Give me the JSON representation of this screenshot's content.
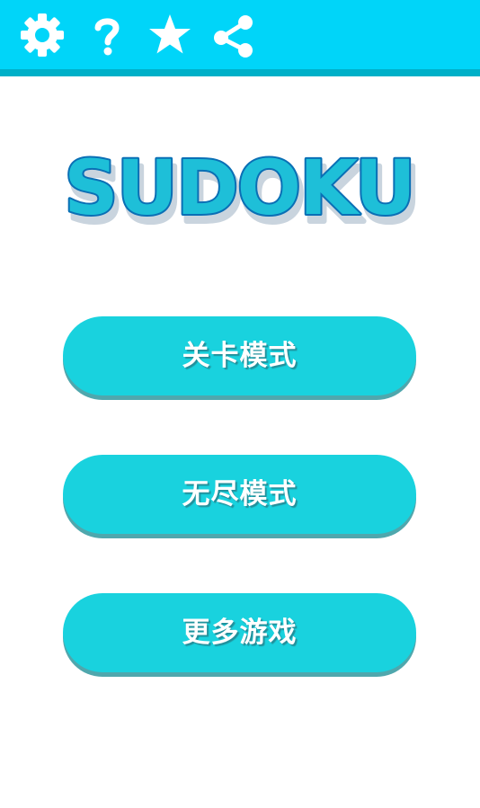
{
  "toolbar": {
    "icons": [
      "gear-icon",
      "help-icon",
      "star-icon",
      "share-icon"
    ],
    "background_color": "#00d5f9",
    "border_color": "#00b0c8",
    "icon_color": "#ffffff"
  },
  "logo": {
    "text": "SUDOKU",
    "fill_color": "#1ebfd8",
    "outline_color": "#0a6fb5",
    "shadow_color": "#c9d4de"
  },
  "menu": {
    "button_color": "#19d2de",
    "items": [
      {
        "label": "关卡模式"
      },
      {
        "label": "无尽模式"
      },
      {
        "label": "更多游戏"
      }
    ]
  }
}
